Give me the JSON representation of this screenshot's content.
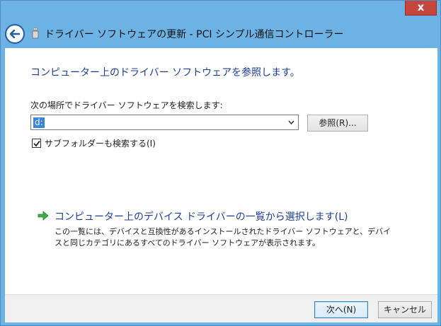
{
  "window": {
    "title": "ドライバー ソフトウェアの更新 - PCI シンプル通信コントローラー",
    "close_label": "x",
    "frame_color": "#6db2e4",
    "close_color": "#c7463b"
  },
  "content": {
    "heading": "コンピューター上のドライバー ソフトウェアを参照します。",
    "search_label": "次の場所でドライバー ソフトウェアを検索します:",
    "path_value": "d:",
    "browse_label": "参照(R)...",
    "include_subfolders_label": "サブフォルダーも検索する(I)",
    "include_subfolders_checked": true,
    "pick_title": "コンピューター上のデバイス ドライバーの一覧から選択します(L)",
    "pick_description": "この一覧には、デバイスと互換性があるインストールされたドライバー ソフトウェアと、デバイスと同じカテゴリにあるすべてのドライバー ソフトウェアが表示されます。",
    "heading_color": "#1d3f93"
  },
  "footer": {
    "next_label": "次へ(N)",
    "cancel_label": "キャンセル"
  },
  "icons": {
    "back": "back-arrow-icon",
    "window": "usb-device-icon",
    "dropdown": "chevron-down-icon",
    "check": "checkmark-icon",
    "pick": "green-arrow-icon"
  }
}
